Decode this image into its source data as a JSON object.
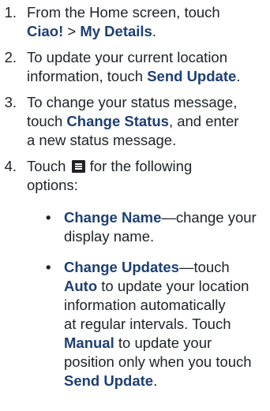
{
  "steps": [
    {
      "number": "1.",
      "lines": [
        [
          "From the Home screen, touch"
        ],
        [
          "Ciao!",
          " > ",
          "My Details",
          "."
        ]
      ]
    },
    {
      "number": "2.",
      "lines": [
        [
          "To update your current location"
        ],
        [
          "information, touch ",
          "Send Update",
          "."
        ]
      ]
    },
    {
      "number": "3.",
      "lines": [
        [
          "To change your status message,"
        ],
        [
          "touch ",
          "Change Status",
          ", and enter"
        ],
        [
          "a new status message."
        ]
      ]
    },
    {
      "number": "4.",
      "lines": [
        [
          "Touch ",
          "for the following"
        ],
        [
          "options:"
        ]
      ]
    }
  ],
  "bullets": [
    {
      "symbol": "•",
      "lines": [
        [
          "Change Name",
          "—change your"
        ],
        [
          "display name."
        ]
      ]
    },
    {
      "symbol": "•",
      "lines": [
        [
          "Change Updates",
          "—touch"
        ],
        [
          "Auto",
          " to update your location"
        ],
        [
          "information automatically"
        ],
        [
          "at regular intervals. Touch"
        ],
        [
          "Manual",
          " to update your"
        ],
        [
          "position only when you touch"
        ],
        [
          "Send Update",
          "."
        ]
      ]
    }
  ],
  "icons": {
    "menu": "menu-icon"
  }
}
